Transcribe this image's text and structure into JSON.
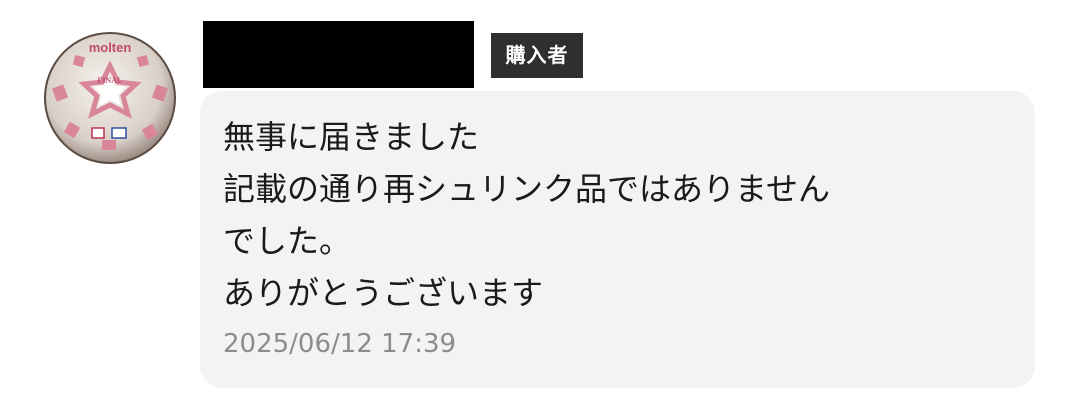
{
  "review": {
    "badge_label": "購入者",
    "message_lines": [
      "無事に届きました",
      "記載の通り再シュリンク品ではありません",
      "でした。",
      "ありがとうございます"
    ],
    "timestamp": "2025/06/12 17:39"
  },
  "avatar": {
    "icon": "soccer-ball-avatar-icon",
    "logo_text": "molten",
    "emblem_text": "FINAL"
  },
  "colors": {
    "badge_bg": "#2f2f2f",
    "bubble_bg": "#f3f3f3",
    "redaction": "#000000",
    "timestamp": "#8c8c8c",
    "ball_accent": "#d9869a"
  }
}
